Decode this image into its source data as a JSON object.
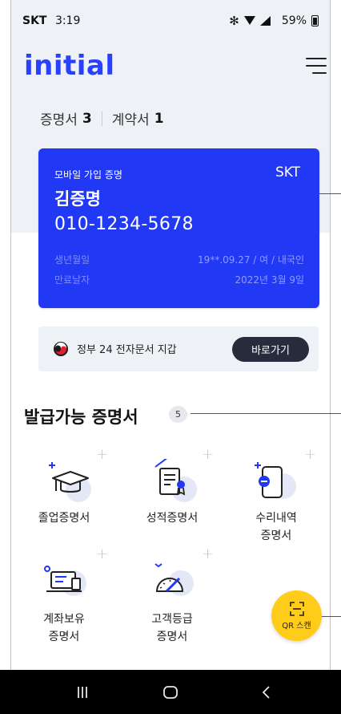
{
  "status_bar": {
    "carrier": "SKT",
    "time": "3:19",
    "battery": "59%",
    "icons": [
      "bluetooth-icon",
      "wifi-icon",
      "signal-icon",
      "battery-icon"
    ]
  },
  "header": {
    "logo": "initial",
    "menu_icon": "hamburger-menu-icon"
  },
  "doc_tabs": [
    {
      "label": "증명서",
      "count": "3"
    },
    {
      "label": "계약서",
      "count": "1"
    }
  ],
  "card": {
    "type": "모바일 가입 증명",
    "carrier": "SKT",
    "name": "김증명",
    "phone": "010-1234-5678",
    "birth_label": "생년월일",
    "birth_value": "19**.09.27 / 여 / 내국인",
    "expiry_label": "만료날자",
    "expiry_value": "2022년 3월 9일",
    "color": "#2138f5"
  },
  "gov_banner": {
    "text": "정부 24 전자문서 지갑",
    "button": "바로가기"
  },
  "section": {
    "title": "발급가능 증명서",
    "count": "5"
  },
  "certificates": [
    {
      "line1": "졸업증명서",
      "line2": "",
      "icon": "graduation-cap-icon"
    },
    {
      "line1": "성적증명서",
      "line2": "",
      "icon": "report-card-icon"
    },
    {
      "line1": "수리내역",
      "line2": "증명서",
      "icon": "phone-repair-icon"
    },
    {
      "line1": "계좌보유",
      "line2": "증명서",
      "icon": "laptop-account-icon"
    },
    {
      "line1": "고객등급",
      "line2": "증명서",
      "icon": "gauge-icon"
    }
  ],
  "fab": {
    "label": "QR 스캔",
    "icon": "qr-scan-icon",
    "color": "#ffcc1a"
  },
  "nav": {
    "icons": [
      "recent-apps-icon",
      "home-icon",
      "back-icon"
    ]
  },
  "colors": {
    "brand": "#2940ff",
    "bg_top": "#eef1f6",
    "dark_button": "#262c3c"
  }
}
